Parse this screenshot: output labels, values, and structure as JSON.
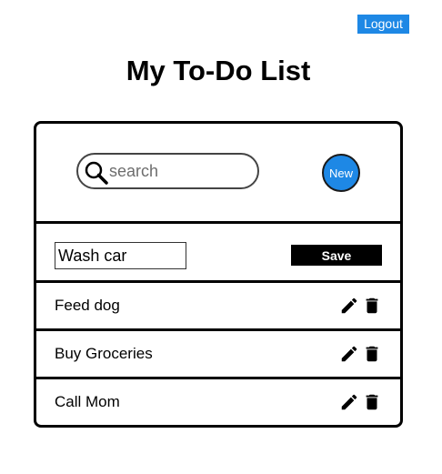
{
  "header": {
    "logout_label": "Logout",
    "title": "My To-Do List"
  },
  "search": {
    "placeholder": "search",
    "value": "",
    "icon": "search-icon"
  },
  "new_button_label": "New",
  "edit_form": {
    "value": "Wash car",
    "save_label": "Save"
  },
  "todos": [
    {
      "text": "Feed dog"
    },
    {
      "text": "Buy Groceries"
    },
    {
      "text": "Call Mom"
    }
  ],
  "icons": {
    "edit": "pencil-icon",
    "delete": "trash-icon"
  },
  "colors": {
    "accent": "#1e88e5",
    "border": "#000000",
    "save_button": "#000000"
  }
}
